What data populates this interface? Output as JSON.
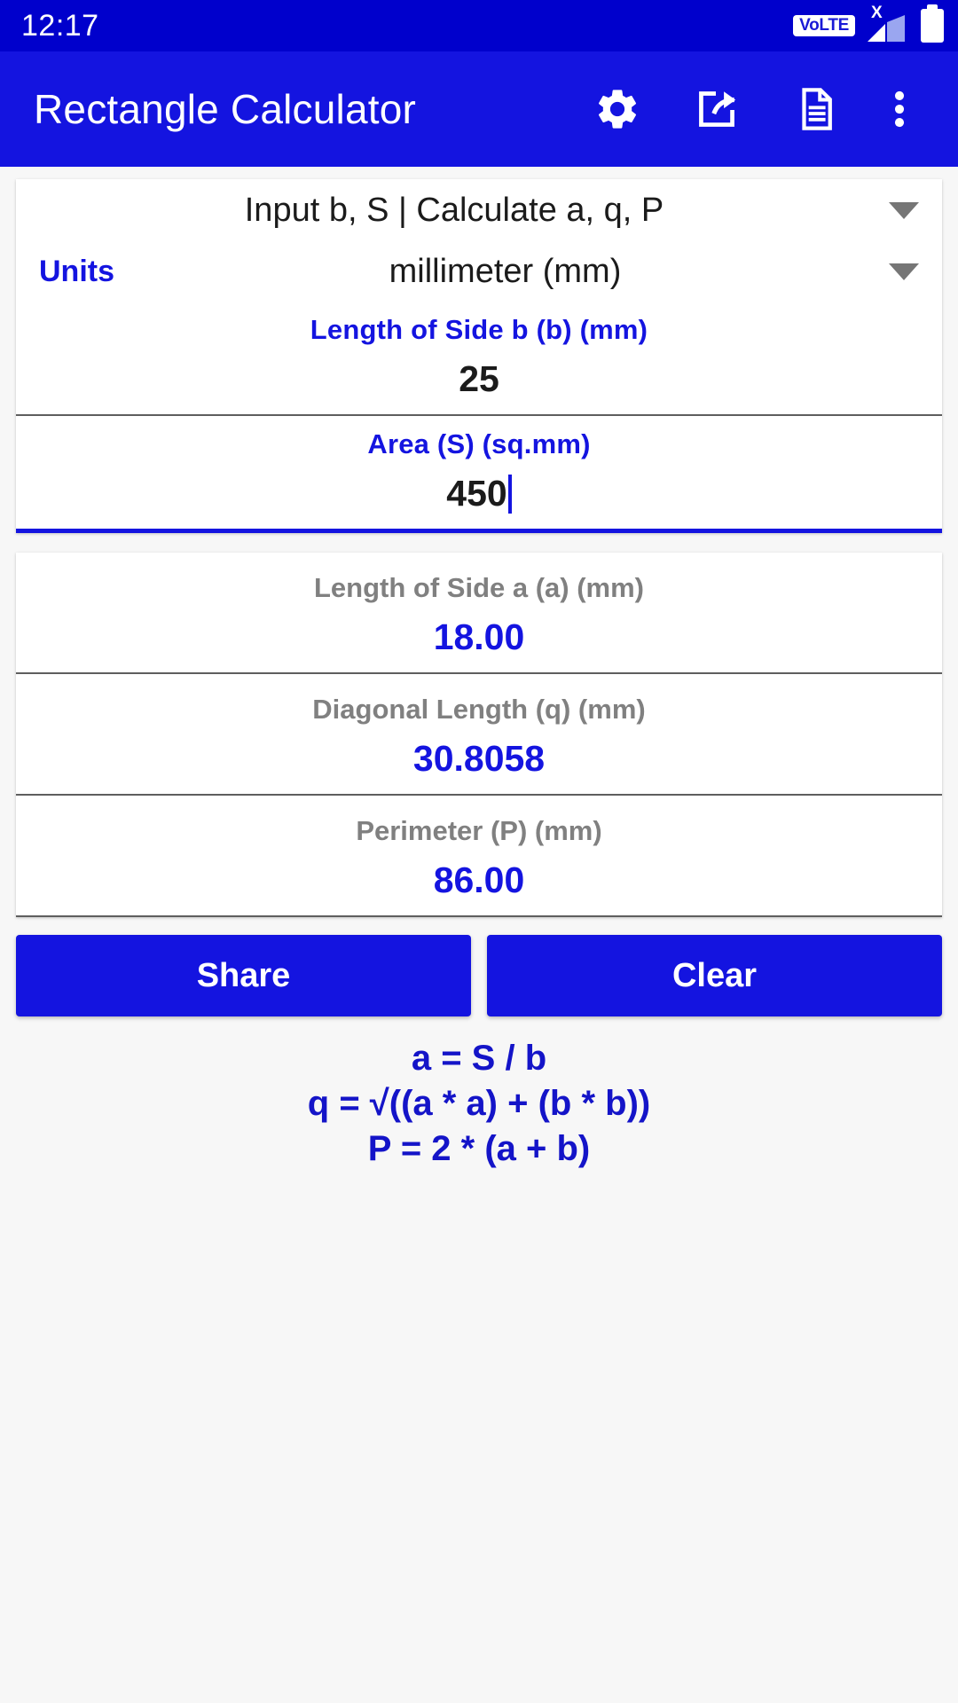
{
  "status_bar": {
    "time": "12:17",
    "volte_label": "VoLTE",
    "signal_x": "X",
    "icons": [
      "volte-badge",
      "signal-bars-icon",
      "battery-icon"
    ]
  },
  "app_bar": {
    "title": "Rectangle Calculator",
    "actions": [
      {
        "name": "settings-icon",
        "label": "Settings"
      },
      {
        "name": "share-export-icon",
        "label": "Share"
      },
      {
        "name": "document-icon",
        "label": "Document"
      },
      {
        "name": "overflow-menu-icon",
        "label": "More options"
      }
    ]
  },
  "input_card": {
    "mode_select": {
      "value": "Input b, S | Calculate a, q, P",
      "caret": "chevron-down-icon"
    },
    "units_select": {
      "label": "Units",
      "value": "millimeter (mm)",
      "caret": "chevron-down-icon"
    },
    "fields": [
      {
        "label": "Length of Side b (b) (mm)",
        "value": "25",
        "focused": false
      },
      {
        "label": "Area (S) (sq.mm)",
        "value": "450",
        "focused": true
      }
    ]
  },
  "results_card": {
    "rows": [
      {
        "label": "Length of Side a (a) (mm)",
        "value": "18.00"
      },
      {
        "label": "Diagonal Length (q) (mm)",
        "value": "30.8058"
      },
      {
        "label": "Perimeter (P) (mm)",
        "value": "86.00"
      }
    ]
  },
  "buttons": {
    "share": "Share",
    "clear": "Clear"
  },
  "formulas": [
    "a = S / b",
    "q = √((a * a) + (b * b))",
    "P = 2 * (a + b)"
  ],
  "colors": {
    "status_bar_blue": "#0000cc",
    "app_bar_blue": "#1414e0",
    "accent_blue": "#1414e0",
    "formula_blue": "#1414c8",
    "label_gray": "#808080",
    "page_background": "#f7f7f7",
    "card_white": "#ffffff",
    "divider_gray": "#5e5e5e"
  }
}
